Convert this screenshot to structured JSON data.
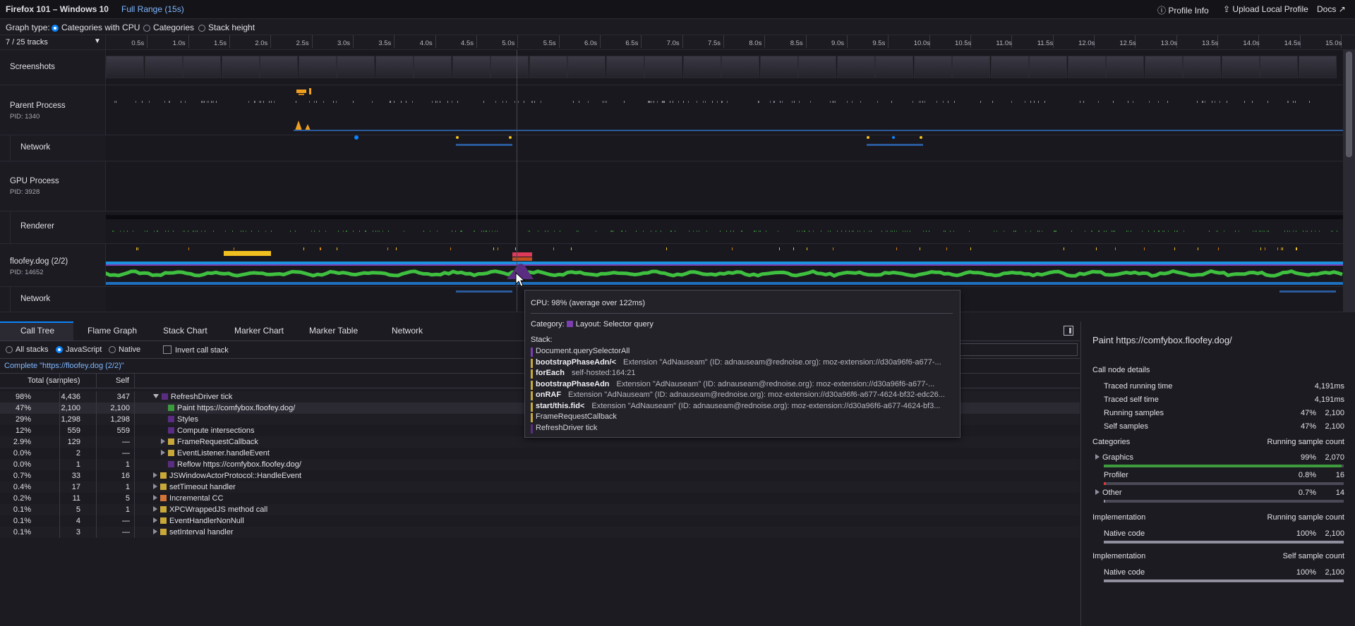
{
  "header": {
    "title": "Firefox 101 – Windows 10",
    "range": "Full Range (15s)",
    "profile_info": "Profile Info",
    "upload": "Upload Local Profile",
    "docs": "Docs"
  },
  "graph_type": {
    "label": "Graph type:",
    "options": [
      "Categories with CPU",
      "Categories",
      "Stack height"
    ],
    "selected": 0
  },
  "timeline": {
    "tracks_count": "7 / 25 tracks",
    "ticks": [
      "0.5s",
      "1.0s",
      "1.5s",
      "2.0s",
      "2.5s",
      "3.0s",
      "3.5s",
      "4.0s",
      "4.5s",
      "5.0s",
      "5.5s",
      "6.0s",
      "6.5s",
      "7.0s",
      "7.5s",
      "8.0s",
      "8.5s",
      "9.0s",
      "9.5s",
      "10.0s",
      "10.5s",
      "11.0s",
      "11.5s",
      "12.0s",
      "12.5s",
      "13.0s",
      "13.5s",
      "14.0s",
      "14.5s",
      "15.0s"
    ],
    "tracks": [
      {
        "name": "Screenshots",
        "pid": ""
      },
      {
        "name": "Parent Process",
        "pid": "PID: 1340"
      },
      {
        "name": "Network",
        "pid": ""
      },
      {
        "name": "GPU Process",
        "pid": "PID: 3928"
      },
      {
        "name": "Renderer",
        "pid": ""
      },
      {
        "name": "floofey.dog (2/2)",
        "pid": "PID: 14652"
      },
      {
        "name": "Network",
        "pid": ""
      }
    ]
  },
  "tabs": [
    "Call Tree",
    "Flame Graph",
    "Stack Chart",
    "Marker Chart",
    "Marker Table",
    "Network"
  ],
  "settings": {
    "stack_options": [
      "All stacks",
      "JavaScript",
      "Native"
    ],
    "selected_stack": 1,
    "invert": "Invert call stack"
  },
  "breadcrumb": "Complete \"https://floofey.dog (2/2)\"",
  "tree": {
    "headers": {
      "total": "Total (samples)",
      "self": "Self"
    },
    "rows": [
      {
        "pct": "98%",
        "total": "4,436",
        "self": "347",
        "name": "RefreshDriver tick",
        "depth": 0,
        "tw": "d",
        "color": "#5a2d82"
      },
      {
        "pct": "47%",
        "total": "2,100",
        "self": "2,100",
        "name": "Paint https://comfybox.floofey.dog/",
        "depth": 1,
        "tw": "",
        "color": "#3d9b3d"
      },
      {
        "pct": "29%",
        "total": "1,298",
        "self": "1,298",
        "name": "Styles",
        "depth": 1,
        "tw": "",
        "color": "#5a2d82"
      },
      {
        "pct": "12%",
        "total": "559",
        "self": "559",
        "name": "Compute intersections",
        "depth": 1,
        "tw": "",
        "color": "#5a2d82"
      },
      {
        "pct": "2.9%",
        "total": "129",
        "self": "—",
        "name": "FrameRequestCallback",
        "depth": 1,
        "tw": "r",
        "color": "#c9a83a"
      },
      {
        "pct": "0.0%",
        "total": "2",
        "self": "—",
        "name": "EventListener.handleEvent",
        "depth": 1,
        "tw": "r",
        "color": "#c9a83a"
      },
      {
        "pct": "0.0%",
        "total": "1",
        "self": "1",
        "name": "Reflow https://comfybox.floofey.dog/",
        "depth": 1,
        "tw": "",
        "color": "#5a2d82"
      },
      {
        "pct": "0.7%",
        "total": "33",
        "self": "16",
        "name": "JSWindowActorProtocol::HandleEvent",
        "depth": 0,
        "tw": "r",
        "color": "#c9a83a"
      },
      {
        "pct": "0.4%",
        "total": "17",
        "self": "1",
        "name": "setTimeout handler",
        "depth": 0,
        "tw": "r",
        "color": "#c9a83a"
      },
      {
        "pct": "0.2%",
        "total": "11",
        "self": "5",
        "name": "Incremental CC",
        "depth": 0,
        "tw": "r",
        "color": "#d2733a"
      },
      {
        "pct": "0.1%",
        "total": "5",
        "self": "1",
        "name": "XPCWrappedJS method call",
        "depth": 0,
        "tw": "r",
        "color": "#c9a83a"
      },
      {
        "pct": "0.1%",
        "total": "4",
        "self": "—",
        "name": "EventHandlerNonNull",
        "depth": 0,
        "tw": "r",
        "color": "#c9a83a"
      },
      {
        "pct": "0.1%",
        "total": "3",
        "self": "—",
        "name": "setInterval handler",
        "depth": 0,
        "tw": "r",
        "color": "#c9a83a"
      }
    ]
  },
  "sidebar": {
    "title": "Paint https://comfybox.floofey.dog/",
    "details_title": "Call node details",
    "details": [
      {
        "label": "Traced running time",
        "pct": "",
        "value": "4,191ms"
      },
      {
        "label": "Traced self time",
        "pct": "",
        "value": "4,191ms"
      },
      {
        "label": "Running samples",
        "pct": "47%",
        "value": "2,100"
      },
      {
        "label": "Self samples",
        "pct": "47%",
        "value": "2,100"
      }
    ],
    "categories_title": "Categories",
    "categories_right": "Running sample count",
    "categories": [
      {
        "label": "Graphics",
        "pct": "99%",
        "value": "2,070",
        "fill": 0.99,
        "color": "#3d9b3d",
        "expandable": true
      },
      {
        "label": "Profiler",
        "pct": "0.8%",
        "value": "16",
        "fill": 0.008,
        "color": "#e03a3a",
        "expandable": false
      },
      {
        "label": "Other",
        "pct": "0.7%",
        "value": "14",
        "fill": 0.007,
        "color": "#8f8f9d",
        "expandable": true
      }
    ],
    "impl_running_title": "Implementation",
    "impl_running_right": "Running sample count",
    "impl_running": {
      "label": "Native code",
      "pct": "100%",
      "value": "2,100",
      "fill": 1.0
    },
    "impl_self_title": "Implementation",
    "impl_self_right": "Self sample count",
    "impl_self": {
      "label": "Native code",
      "pct": "100%",
      "value": "2,100",
      "fill": 1.0
    }
  },
  "tooltip": {
    "cpu_label": "CPU:",
    "cpu_value": "98% (average over 122ms)",
    "category_label": "Category:",
    "category_value": "Layout: Selector query",
    "category_color": "#7b3fb0",
    "stack_label": "Stack:",
    "stack": [
      {
        "fn": "Document.querySelectorAll",
        "res": "",
        "color": "#7b3fb0",
        "bold": false
      },
      {
        "fn": "bootstrapPhaseAdn/<",
        "res": "Extension \"AdNauseam\" (ID: adnauseam@rednoise.org): moz-extension://d30a96f6-a677-...",
        "color": "#c9a83a",
        "bold": true
      },
      {
        "fn": "forEach",
        "res": "self-hosted:164:21",
        "color": "#c9a83a",
        "bold": true
      },
      {
        "fn": "bootstrapPhaseAdn",
        "res": "Extension \"AdNauseam\" (ID: adnauseam@rednoise.org): moz-extension://d30a96f6-a677-...",
        "color": "#c9a83a",
        "bold": true
      },
      {
        "fn": "onRAF",
        "res": "Extension \"AdNauseam\" (ID: adnauseam@rednoise.org): moz-extension://d30a96f6-a677-4624-bf32-edc26...",
        "color": "#c9a83a",
        "bold": true
      },
      {
        "fn": "start/this.fid<",
        "res": "Extension \"AdNauseam\" (ID: adnauseam@rednoise.org): moz-extension://d30a96f6-a677-4624-bf3...",
        "color": "#c9a83a",
        "bold": true
      },
      {
        "fn": "FrameRequestCallback",
        "res": "",
        "color": "#c9a83a",
        "bold": false
      },
      {
        "fn": "RefreshDriver tick",
        "res": "",
        "color": "#5a2d82",
        "bold": false
      }
    ]
  }
}
